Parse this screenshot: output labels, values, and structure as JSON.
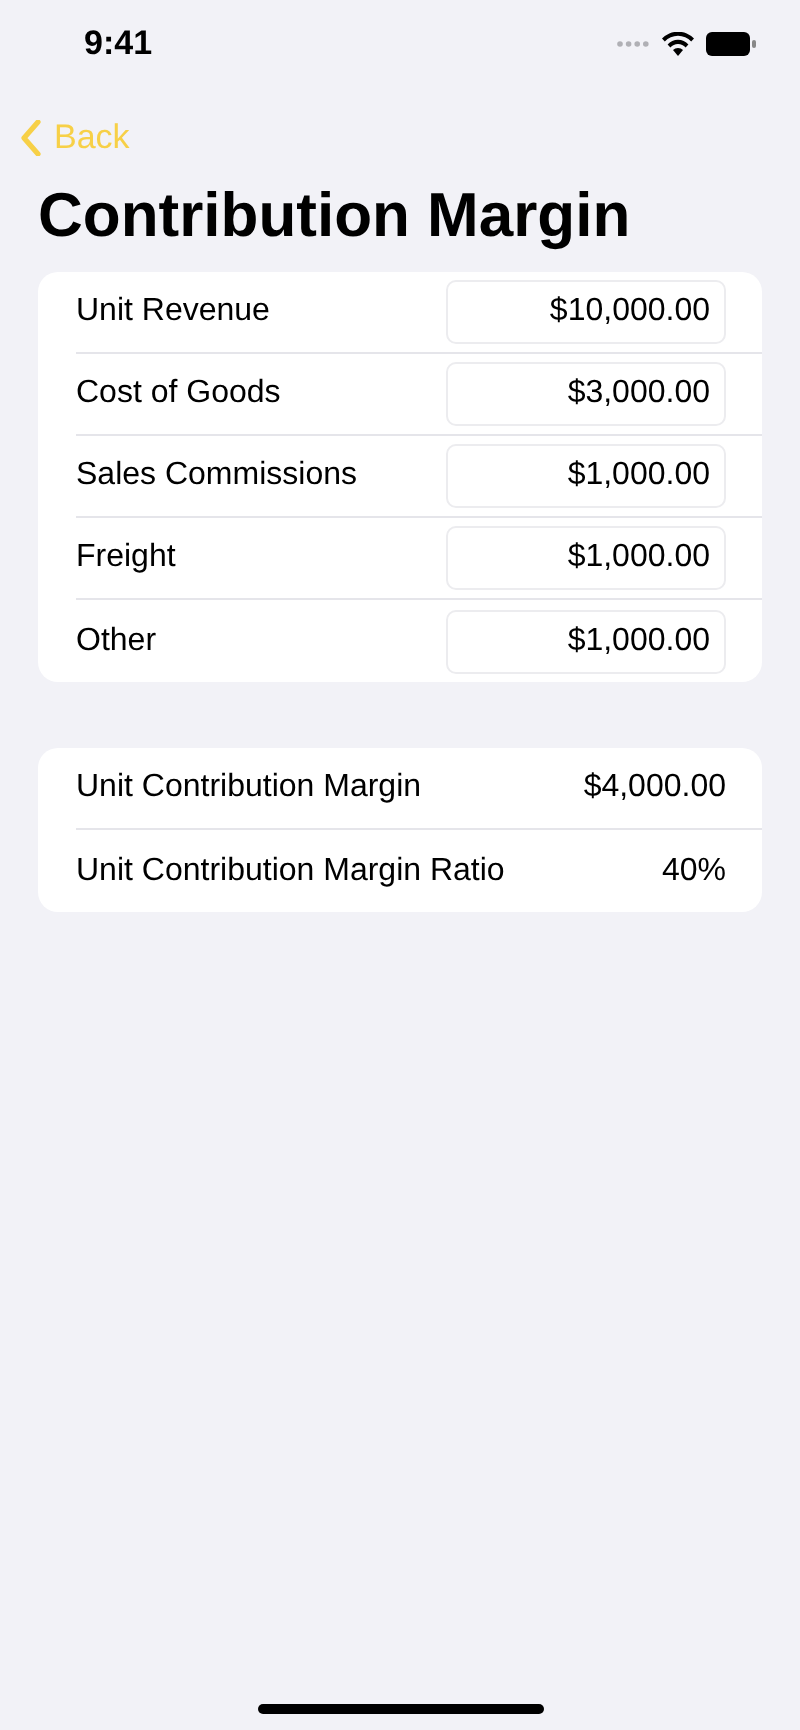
{
  "status_bar": {
    "time": "9:41"
  },
  "nav": {
    "back": "Back"
  },
  "title": "Contribution Margin",
  "inputs": [
    {
      "label": "Unit Revenue",
      "value": "$10,000.00"
    },
    {
      "label": "Cost of Goods",
      "value": "$3,000.00"
    },
    {
      "label": "Sales Commissions",
      "value": "$1,000.00"
    },
    {
      "label": "Freight",
      "value": "$1,000.00"
    },
    {
      "label": "Other",
      "value": "$1,000.00"
    }
  ],
  "results": [
    {
      "label": "Unit Contribution Margin",
      "value": "$4,000.00"
    },
    {
      "label": "Unit Contribution Margin Ratio",
      "value": "40%"
    }
  ]
}
